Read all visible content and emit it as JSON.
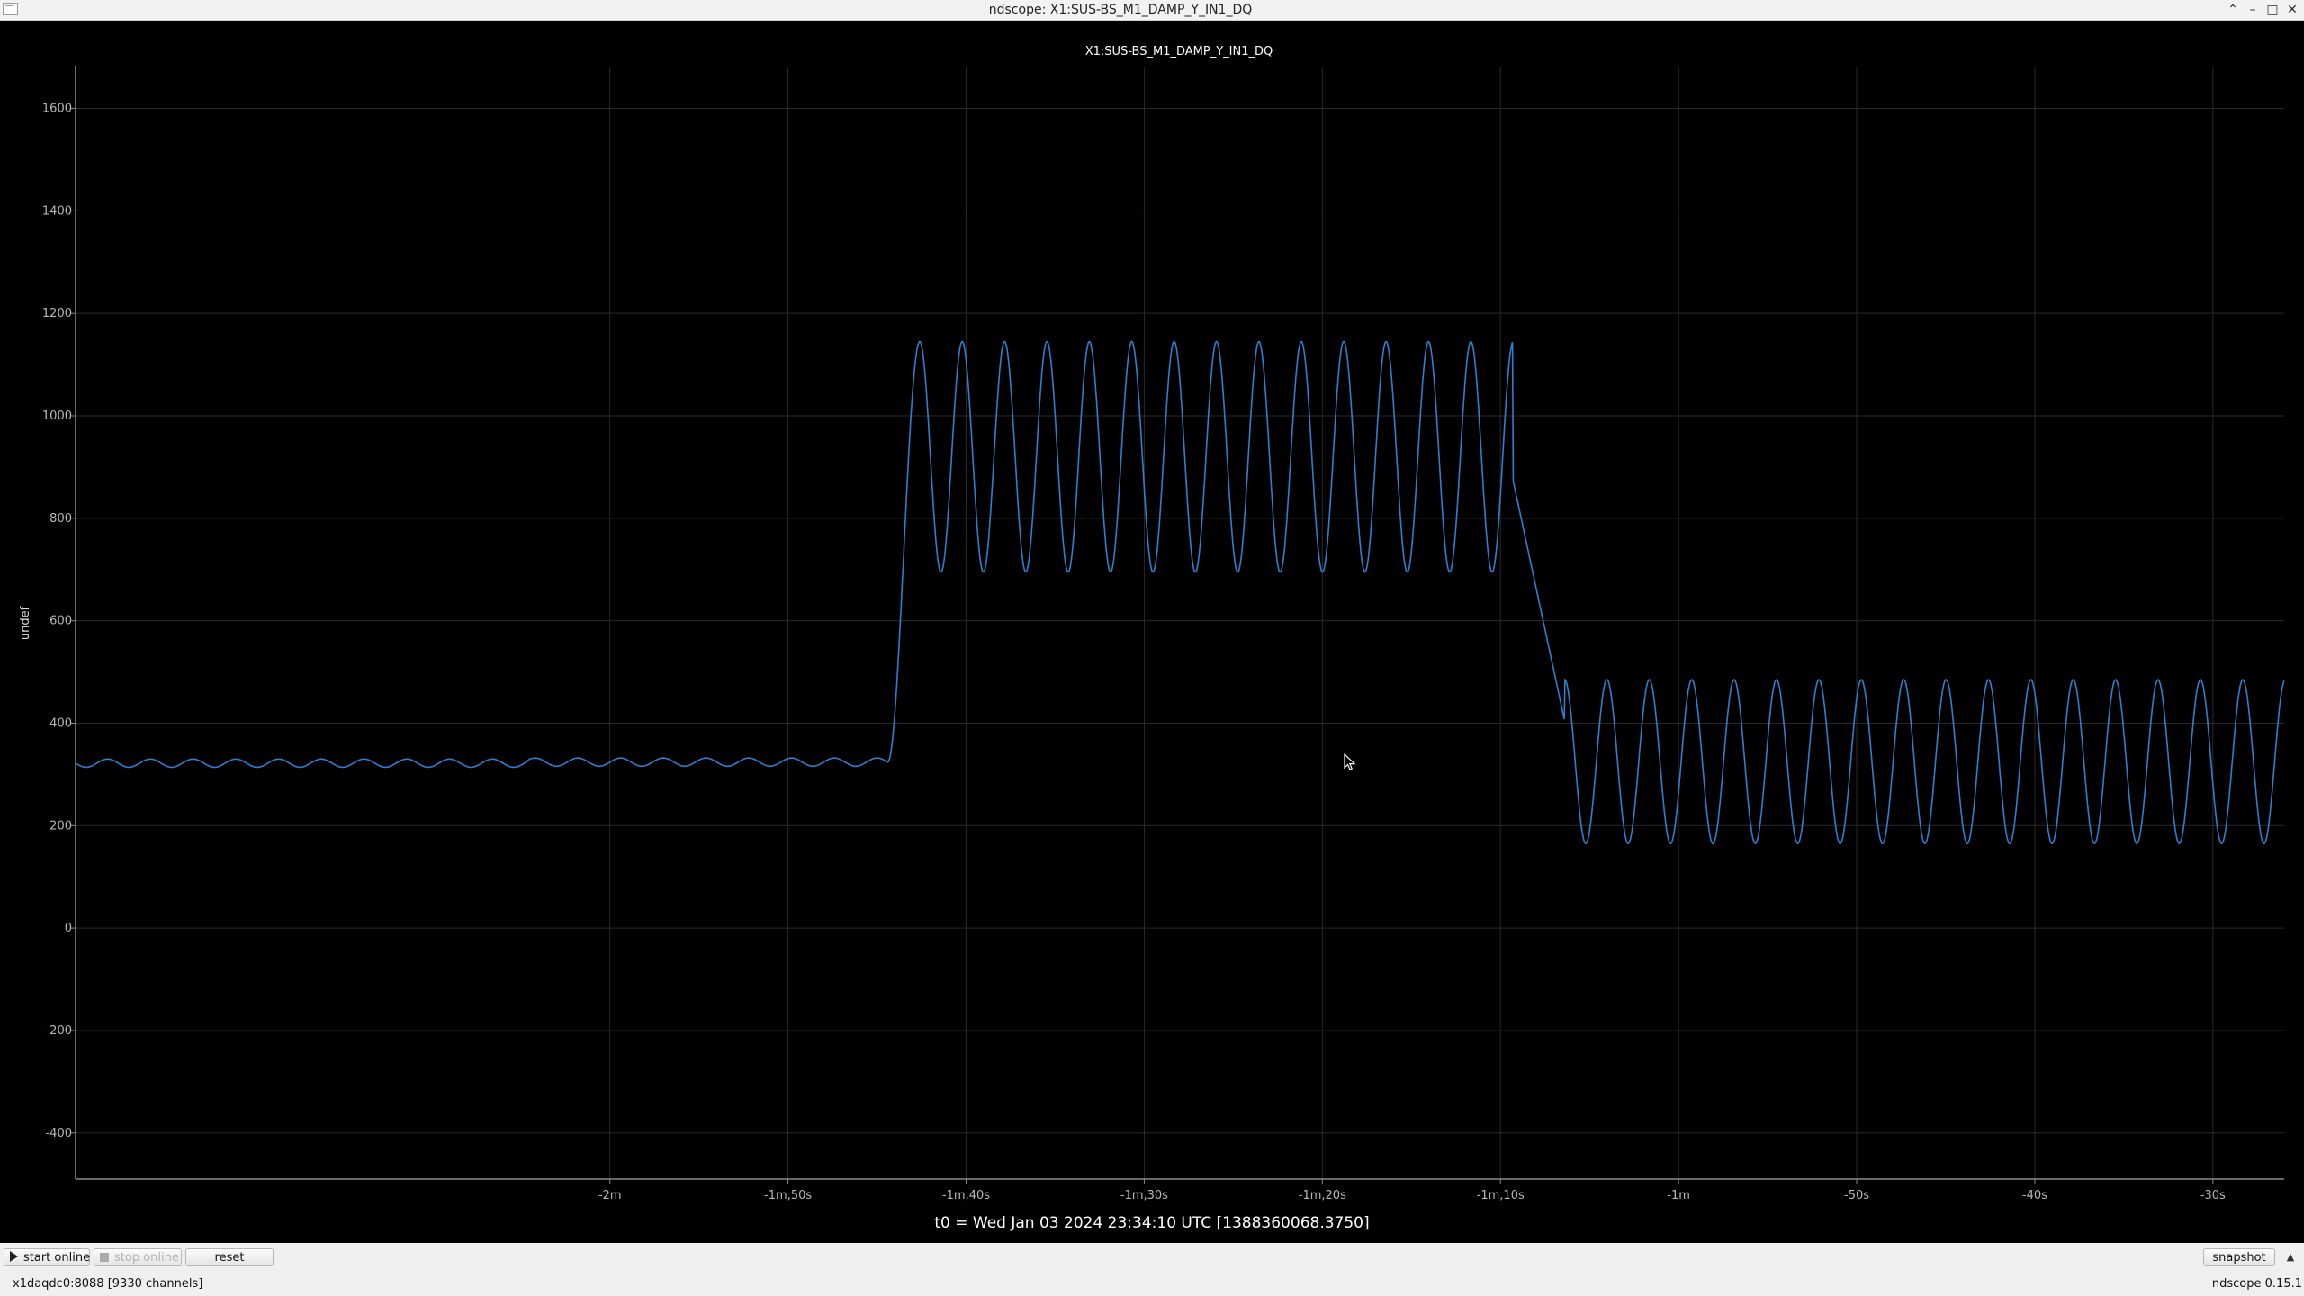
{
  "window": {
    "title": "ndscope: X1:SUS-BS_M1_DAMP_Y_IN1_DQ",
    "buttons": {
      "restore": "⌃",
      "minimize": "–",
      "maximize": "□",
      "close": "✕"
    }
  },
  "plot": {
    "title": "X1:SUS-BS_M1_DAMP_Y_IN1_DQ",
    "t0_label": "t0 = Wed Jan 03 2024 23:34:10 UTC [1388360068.3750]"
  },
  "controls": {
    "start_online": "start online",
    "stop_online": "stop online",
    "reset": "reset",
    "snapshot": "snapshot",
    "collapse_icon": "▲"
  },
  "status": {
    "server": "x1daqdc0:8088  [9330 channels]",
    "version": "ndscope 0.15.1"
  },
  "colors": {
    "trace": "#2f7fcf",
    "grid": "#2a2a2a",
    "axis": "#8a8a8a",
    "background": "#000000"
  },
  "chart_data": {
    "type": "line",
    "title": "X1:SUS-BS_M1_DAMP_Y_IN1_DQ",
    "xlabel": "",
    "ylabel": "undef",
    "xlim": [
      -150,
      -26
    ],
    "ylim": [
      -490,
      1680
    ],
    "grid": true,
    "x_ticks": [
      {
        "value": -120,
        "label": "-2m"
      },
      {
        "value": -110,
        "label": "-1m,50s"
      },
      {
        "value": -100,
        "label": "-1m,40s"
      },
      {
        "value": -90,
        "label": "-1m,30s"
      },
      {
        "value": -80,
        "label": "-1m,20s"
      },
      {
        "value": -70,
        "label": "-1m,10s"
      },
      {
        "value": -60,
        "label": "-1m"
      },
      {
        "value": -50,
        "label": "-50s"
      },
      {
        "value": -40,
        "label": "-40s"
      },
      {
        "value": -30,
        "label": "-30s"
      }
    ],
    "y_ticks": [
      -400,
      -200,
      0,
      200,
      400,
      600,
      800,
      1000,
      1200,
      1400,
      1600
    ],
    "series": [
      {
        "segments": [
          {
            "x_start": -150,
            "x_end": -124.6,
            "mean": 322,
            "amplitude": 8,
            "period": 2.4
          },
          {
            "x_start": -124.6,
            "x_end": -104.4,
            "mean": 324,
            "amplitude": 8,
            "period": 2.4
          },
          {
            "x_start": -104.4,
            "x_end": -102.6,
            "mean": 700,
            "amplitude": 0,
            "period": 0,
            "note": "step up"
          },
          {
            "x_start": -102.6,
            "x_end": -69.3,
            "mean": 920,
            "amplitude": 225,
            "period": 2.38
          },
          {
            "x_start": -69.3,
            "x_end": -66.4,
            "mean": 520,
            "amplitude": 0,
            "period": 0,
            "note": "step down"
          },
          {
            "x_start": -66.4,
            "x_end": -26,
            "mean": 325,
            "amplitude": 160,
            "period": 2.38
          }
        ],
        "values_summary": {
          "pre_step_level": 322,
          "excited_peaks": [
            1143,
            1155,
            1137,
            1155,
            1136,
            1155,
            1145,
            1149,
            1149,
            1140,
            1145,
            1131,
            1138,
            1131,
            1135
          ],
          "excited_troughs": [
            665,
            700,
            680,
            695,
            690,
            695,
            700,
            700,
            705,
            710,
            720,
            715,
            725
          ],
          "post_step_peaks": [
            490,
            505,
            490,
            495,
            492,
            485,
            492,
            488,
            475,
            480,
            478,
            475,
            475,
            475,
            472,
            470,
            470,
            465
          ],
          "post_step_troughs": [
            165,
            155,
            160,
            165,
            160,
            160,
            160,
            165,
            165,
            170,
            170,
            170,
            172
          ]
        }
      }
    ]
  }
}
